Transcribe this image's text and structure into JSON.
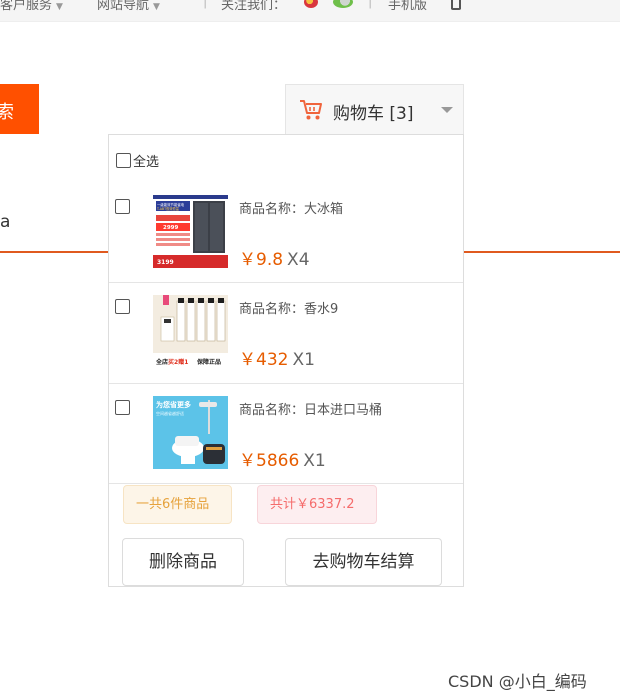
{
  "topbar": {
    "items": [
      {
        "label": "客户服务"
      },
      {
        "label": "网站导航"
      },
      {
        "label": "关注我们："
      },
      {
        "label": "手机版"
      }
    ]
  },
  "left": {
    "orange_text": "索",
    "letter": "a"
  },
  "cart": {
    "label": "购物车 [3]",
    "check_all": "全选",
    "items": [
      {
        "name": "商品名称：大冰箱",
        "price": "￥9.8",
        "qty": "X4"
      },
      {
        "name": "商品名称：香水9",
        "price": "￥432",
        "qty": "X1"
      },
      {
        "name": "商品名称：日本进口马桶",
        "price": "￥5866",
        "qty": "X1"
      }
    ],
    "count_tag": "一共6件商品",
    "total_tag": "共计￥6337.2",
    "delete_button": "删除商品",
    "checkout_button": "去购物车结算"
  },
  "thumb_text": {
    "fridge_top": "一级能效节能省电",
    "fridge_sub": "T-ABT双效恒温",
    "fridge_price": "2999",
    "fridge_bottom": "3199",
    "perfume_tag1": "全店",
    "perfume_tag2": "买2赠1",
    "perfume_tag3": "保障正品",
    "toilet_title": "为您省更多",
    "toilet_sub": "空间越省越舒适"
  },
  "watermark": "CSDN @小白_编码",
  "colors": {
    "accent": "#ff5000",
    "price": "#e65c00",
    "count_tag": "#e6a23c",
    "total_tag": "#f56c6c"
  }
}
